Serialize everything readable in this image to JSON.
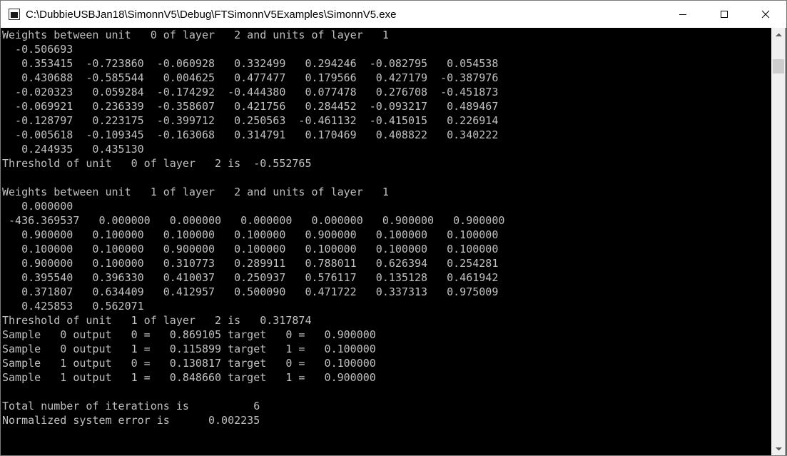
{
  "window": {
    "title": "C:\\DubbieUSBJan18\\SimonnV5\\Debug\\FTSimonnV5Examples\\SimonnV5.exe",
    "caption_buttons": {
      "minimize_icon": "minimize-icon",
      "maximize_icon": "maximize-icon",
      "close_icon": "close-icon"
    }
  },
  "colors": {
    "console_background": "#000000",
    "console_text": "#c0c0c0",
    "titlebar_background": "#ffffff",
    "scrollbar_track": "#f0f0f0",
    "scrollbar_thumb": "#cdcdcd"
  },
  "console": {
    "lines": [
      "Weights between unit   0 of layer   2 and units of layer   1",
      "  -0.506693",
      "   0.353415  -0.723860  -0.060928   0.332499   0.294246  -0.082795   0.054538",
      "   0.430688  -0.585544   0.004625   0.477477   0.179566   0.427179  -0.387976",
      "  -0.020323   0.059284  -0.174292  -0.444380   0.077478   0.276708  -0.451873",
      "  -0.069921   0.236339  -0.358607   0.421756   0.284452  -0.093217   0.489467",
      "  -0.128797   0.223175  -0.399712   0.250563  -0.461132  -0.415015   0.226914",
      "  -0.005618  -0.109345  -0.163068   0.314791   0.170469   0.408822   0.340222",
      "   0.244935   0.435130",
      "Threshold of unit   0 of layer   2 is  -0.552765",
      "",
      "Weights between unit   1 of layer   2 and units of layer   1",
      "   0.000000",
      " -436.369537   0.000000   0.000000   0.000000   0.000000   0.900000   0.900000",
      "   0.900000   0.100000   0.100000   0.100000   0.900000   0.100000   0.100000",
      "   0.100000   0.100000   0.900000   0.100000   0.100000   0.100000   0.100000",
      "   0.900000   0.100000   0.310773   0.289911   0.788011   0.626394   0.254281",
      "   0.395540   0.396330   0.410037   0.250937   0.576117   0.135128   0.461942",
      "   0.371807   0.634409   0.412957   0.500090   0.471722   0.337313   0.975009",
      "   0.425853   0.562071",
      "Threshold of unit   1 of layer   2 is   0.317874",
      "Sample   0 output   0 =   0.869105 target   0 =   0.900000",
      "Sample   0 output   1 =   0.115899 target   1 =   0.100000",
      "Sample   1 output   0 =   0.130817 target   0 =   0.100000",
      "Sample   1 output   1 =   0.848660 target   1 =   0.900000",
      "",
      "Total number of iterations is          6",
      "Normalized system error is      0.002235"
    ]
  }
}
